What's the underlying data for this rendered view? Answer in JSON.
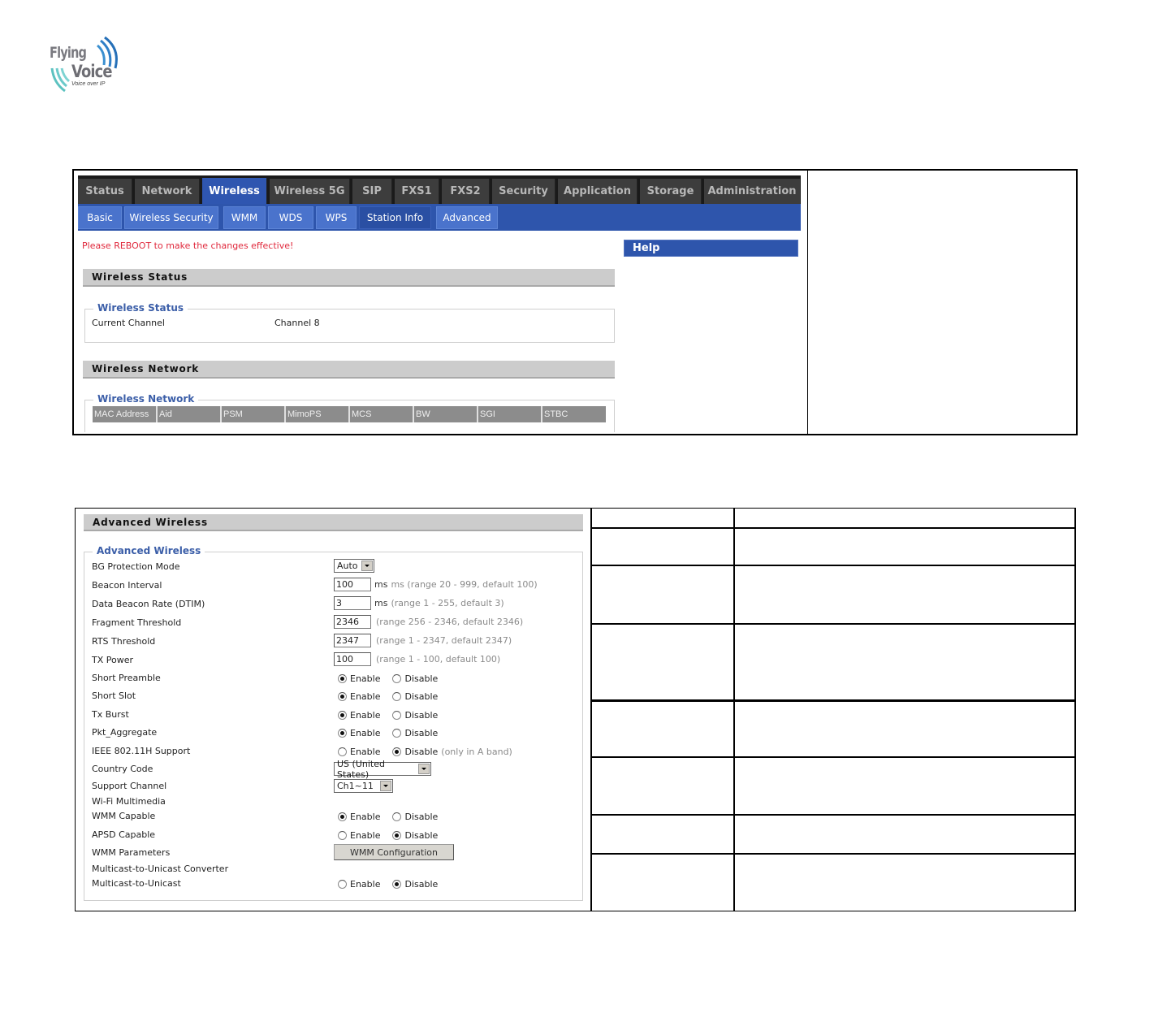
{
  "logo": {
    "line1": "Flying",
    "line2": "Voice",
    "tagline": "Voice over IP"
  },
  "panel1": {
    "top_tabs": [
      {
        "label": "Status",
        "active": false
      },
      {
        "label": "Network",
        "active": false
      },
      {
        "label": "Wireless",
        "active": true
      },
      {
        "label": "Wireless 5G",
        "active": false
      },
      {
        "label": "SIP",
        "active": false
      },
      {
        "label": "FXS1",
        "active": false
      },
      {
        "label": "FXS2",
        "active": false
      },
      {
        "label": "Security",
        "active": false
      },
      {
        "label": "Application",
        "active": false
      },
      {
        "label": "Storage",
        "active": false
      },
      {
        "label": "Administration",
        "active": false
      }
    ],
    "sub_tabs": [
      {
        "label": "Basic",
        "active": false
      },
      {
        "label": "Wireless Security",
        "active": false
      },
      {
        "label": "WMM",
        "active": false
      },
      {
        "label": "WDS",
        "active": false
      },
      {
        "label": "WPS",
        "active": false
      },
      {
        "label": "Station Info",
        "active": true
      },
      {
        "label": "Advanced",
        "active": false
      }
    ],
    "reboot_notice": "Please REBOOT to make the changes effective!",
    "help_title": "Help",
    "wireless_status": {
      "section_title": "Wireless Status",
      "legend": "Wireless Status",
      "current_channel_label": "Current Channel",
      "current_channel_value": "Channel 8"
    },
    "wireless_network": {
      "section_title": "Wireless Network",
      "legend": "Wireless Network",
      "columns": [
        "MAC Address",
        "Aid",
        "PSM",
        "MimoPS",
        "MCS",
        "BW",
        "SGI",
        "STBC"
      ]
    }
  },
  "panel2": {
    "section_title": "Advanced Wireless",
    "legend": "Advanced Wireless",
    "fields": {
      "bg_protection": {
        "label": "BG Protection Mode",
        "value": "Auto"
      },
      "beacon_interval": {
        "label": "Beacon Interval",
        "value": "100",
        "unit": "ms",
        "hint": "ms (range 20 - 999, default 100)"
      },
      "dtim": {
        "label": "Data Beacon Rate (DTIM)",
        "value": "3",
        "unit": "ms",
        "hint": "(range 1 - 255, default 3)"
      },
      "fragment": {
        "label": "Fragment Threshold",
        "value": "2346",
        "hint": "(range 256 - 2346, default 2346)"
      },
      "rts": {
        "label": "RTS Threshold",
        "value": "2347",
        "hint": "(range 1 - 2347, default 2347)"
      },
      "tx_power": {
        "label": "TX Power",
        "value": "100",
        "hint": "(range 1 - 100, default 100)"
      },
      "short_preamble": {
        "label": "Short Preamble",
        "selected": "Enable"
      },
      "short_slot": {
        "label": "Short Slot",
        "selected": "Enable"
      },
      "tx_burst": {
        "label": "Tx Burst",
        "selected": "Enable"
      },
      "pkt_aggregate": {
        "label": "Pkt_Aggregate",
        "selected": "Enable"
      },
      "ieee_80211h": {
        "label": "IEEE 802.11H Support",
        "selected": "Disable",
        "hint": "(only in A band)"
      },
      "country_code": {
        "label": "Country Code",
        "value": "US (United States)"
      },
      "support_channel": {
        "label": "Support Channel",
        "value": "Ch1~11"
      },
      "wifi_multimedia": {
        "label": "Wi-Fi Multimedia"
      },
      "wmm_capable": {
        "label": "WMM Capable",
        "selected": "Enable"
      },
      "apsd_capable": {
        "label": "APSD Capable",
        "selected": "Disable"
      },
      "wmm_parameters": {
        "label": "WMM Parameters",
        "button": "WMM Configuration"
      },
      "m2u_converter": {
        "label": "Multicast-to-Unicast Converter"
      },
      "m2u": {
        "label": "Multicast-to-Unicast",
        "selected": "Disable"
      }
    },
    "enable_label": "Enable",
    "disable_label": "Disable"
  }
}
